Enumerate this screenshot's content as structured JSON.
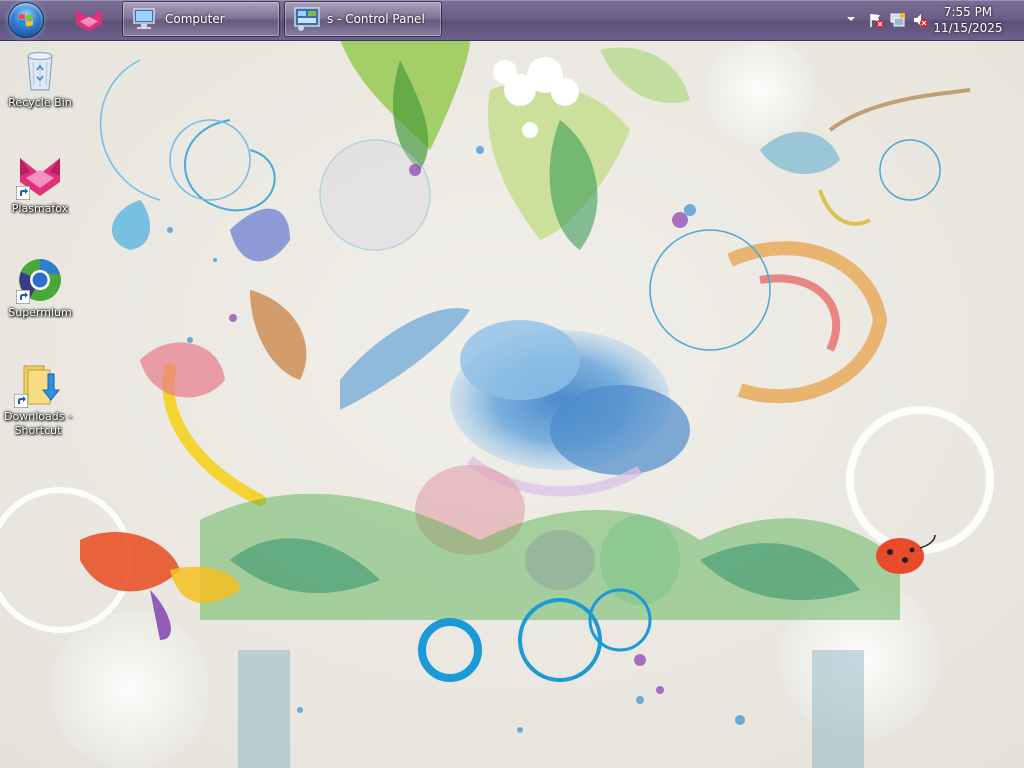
{
  "taskbar": {
    "start_icon": "windows-start-orb",
    "quick_launch_icon": "plasmafox-icon",
    "tasks": [
      {
        "label": "Computer",
        "icon": "computer-icon"
      },
      {
        "label": "s - Control Panel",
        "icon": "control-panel-icon"
      }
    ],
    "tray": {
      "icons": [
        "show-hidden-icons-chevron",
        "action-center-flag-icon",
        "network-icon",
        "volume-muted-icon"
      ],
      "time": "7:55 PM",
      "date": "11/15/2025"
    }
  },
  "desktop": {
    "icons": [
      {
        "label": "Recycle Bin",
        "icon": "recycle-bin-icon",
        "shortcut": false
      },
      {
        "label": "Plasmafox",
        "icon": "plasmafox-icon",
        "shortcut": true
      },
      {
        "label": "Supermium",
        "icon": "supermium-icon",
        "shortcut": true
      },
      {
        "label": "Downloads - Shortcut",
        "icon": "folder-downloads-icon",
        "shortcut": true
      }
    ],
    "wallpaper": "floral-watercolor-birds"
  },
  "colors": {
    "taskbar": "#6b5f88",
    "desktop_bg": "#ebe9e2",
    "accent_blue": "#2f7fd4"
  }
}
